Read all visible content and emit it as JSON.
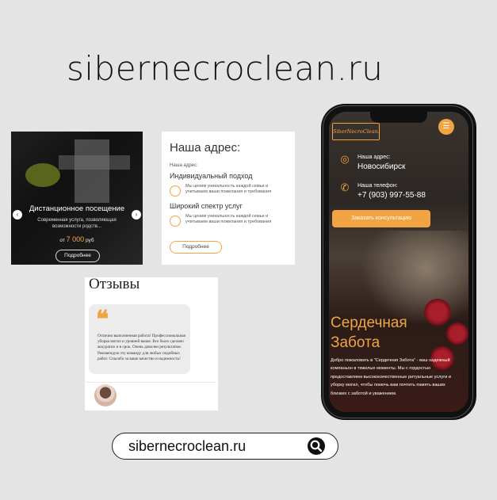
{
  "site_title": "sibernecroclean.ru",
  "slider_card": {
    "title": "Дистанционное посещение",
    "description": "Современная услуга, позволяющая возможности родств...",
    "price_prefix": "от",
    "price_value": "7 000",
    "price_unit": "руб",
    "button": "Подробнее",
    "prev_arrow": "‹",
    "next_arrow": "›"
  },
  "address_card": {
    "heading": "Наша адрес:",
    "subheading": "Наша адрес:",
    "feature1_title": "Индивидуальный подход",
    "feature1_text": "Мы ценим уникальность каждой семьи и учитываем ваши пожелания и требования",
    "feature2_title": "Широкий спектр услуг",
    "feature2_text": "Мы ценим уникальность каждой семьи и учитываем ваши пожелания и требования",
    "button": "Подробнее"
  },
  "reviews_card": {
    "heading": "Отзывы",
    "quote_mark": "❝",
    "text": "Отлично выполненная работа! Профессиональная уборка могил и уровней выше. Все было сделано аккуратно и в срок. Очень доволен результатом. Рекомендую эту команду для любых подобных работ. Спасибо за ваше качество и надежность!"
  },
  "phone": {
    "logo": "SiberNecroClean.ru",
    "menu_icon": "☰",
    "address_label": "Наша адрес:",
    "address_value": "Новосибирск",
    "phone_label": "Наша телефон:",
    "phone_value": "+7 (903) 997-55-88",
    "consult_button": "Заказать консультацию",
    "hero_title": "Сердечная Забота",
    "hero_text": "Добро пожаловать в \"Сердечная Забота\" - ваш надежный компаньон в тяжелые моменты. Мы с гордостью предоставляем высококачественные ритуальные услуги и уборку могил, чтобы помочь вам почтить память ваших близких с заботой и уважением."
  },
  "search": {
    "text": "sibernecroclean.ru"
  },
  "colors": {
    "accent": "#f2a443",
    "background": "#e4e4e4"
  }
}
